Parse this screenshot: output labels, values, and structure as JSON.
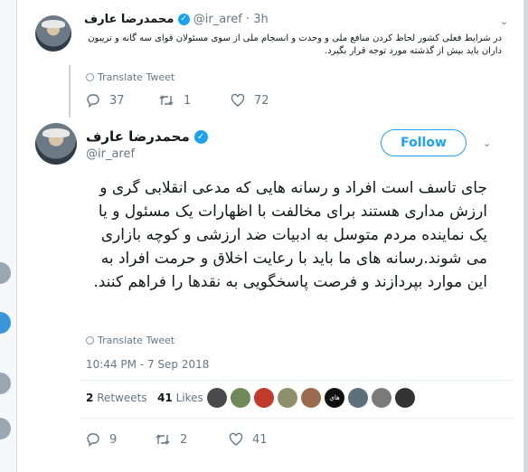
{
  "reply_tweet": {
    "display_name": "محمدرضا عارف",
    "handle": "@ir_aref",
    "time": "· 3h",
    "text": "در شرایط فعلی کشور لحاظ کردن منافع ملی و وحدت و انسجام ملی از سوی مسئولان قوای سه گانه و تریبون داران باید بیش از گذشته مورد توجه قرار بگیرد.",
    "translate_label": "Translate Tweet",
    "replies": "37",
    "retweets": "1",
    "likes": "72"
  },
  "main_tweet": {
    "display_name": "محمدرضا عارف",
    "handle": "@ir_aref",
    "follow_label": "Follow",
    "text": "جای تاسف است افراد و رسانه هایی که مدعی انقلابی گری و ارزش مداری هستند برای مخالفت با اظهارات یک مسئول و یا یک نماینده مردم متوسل به ادبیات ضد ارزشی و کوچه بازاری می شوند.رسانه های ما باید با رعایت اخلاق و حرمت افراد به این موارد بپردازند و فرصت پاسخگویی به نقدها را فراهم کنند.",
    "translate_label": "Translate Tweet",
    "timestamp": "10:44 PM - 7 Sep 2018",
    "stats": {
      "retweets_count": "2",
      "retweets_label": "Retweets",
      "likes_count": "41",
      "likes_label": "Likes"
    },
    "engager_badge_text": "هاي",
    "replies": "9",
    "retweets": "2",
    "likes": "41"
  },
  "colors": {
    "accent": "#1da1f2",
    "muted": "#657786",
    "divider": "#e6ecf0"
  },
  "icons": [
    "reply-icon",
    "retweet-icon",
    "like-icon",
    "globe-icon",
    "verified-icon",
    "chevron-down-icon"
  ]
}
